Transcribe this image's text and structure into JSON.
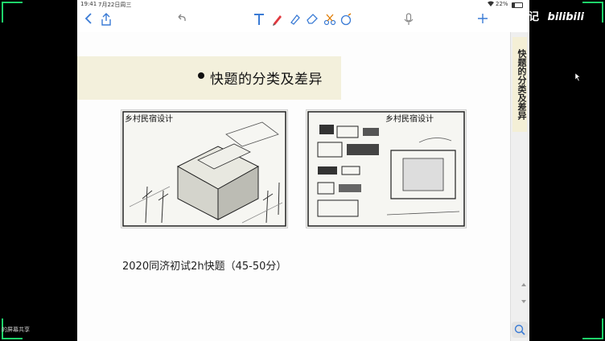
{
  "status": {
    "time": "19:41",
    "date": "7月22日周三",
    "battery": "22%"
  },
  "toolbar": {
    "back_icon": "chevron-left-icon",
    "share_icon": "share-icon",
    "undo_icon": "undo-icon",
    "text_tool_icon": "text-tool-icon",
    "pen_icon": "pen-icon",
    "highlighter_icon": "highlighter-icon",
    "eraser_icon": "eraser-icon",
    "scissors_icon": "lasso-icon",
    "shape_icon": "shape-icon",
    "mic_icon": "microphone-icon",
    "add_icon": "plus-icon"
  },
  "slide": {
    "title": "快题的分类及差异",
    "left_sketch_heading": "乡村民宿设计",
    "right_sketch_heading": "乡村民宿设计",
    "caption": "2020同济初试2h快题（45-50分）"
  },
  "outline": {
    "tab_label": "快题的分类及差异"
  },
  "overlay": {
    "channel_name": "匪山行记",
    "logo": "bilibili",
    "watermark": "的屏幕共享"
  },
  "colors": {
    "accent": "#1fd36a",
    "title_band": "#f3f0dc",
    "pen": "#e0383e"
  }
}
